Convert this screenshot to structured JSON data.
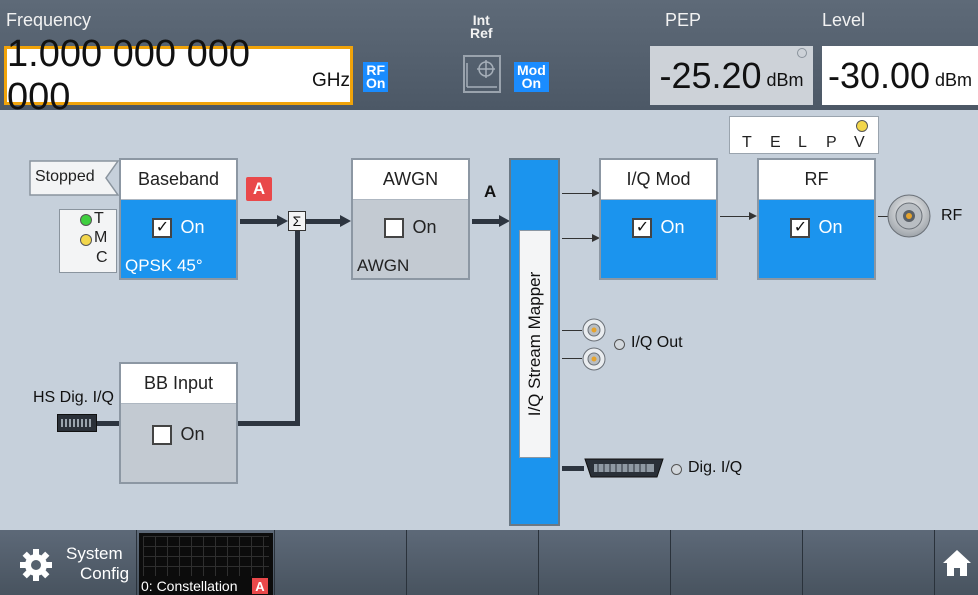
{
  "header": {
    "frequency_label": "Frequency",
    "frequency_value": "1.000 000 000 000",
    "frequency_unit": "GHz",
    "rf_status": [
      "RF",
      "On"
    ],
    "ref_label": [
      "Int",
      "Ref"
    ],
    "mod_status": [
      "Mod",
      "On"
    ],
    "pep_label": "PEP",
    "pep_value": "-25.20",
    "pep_unit": "dBm",
    "level_label": "Level",
    "level_value": "-30.00",
    "level_unit": "dBm"
  },
  "status_indicators": [
    "T",
    "E",
    "L",
    "P",
    "V"
  ],
  "diagram": {
    "stopped_label": "Stopped",
    "trigger_leds": [
      "T",
      "M",
      "C"
    ],
    "baseband": {
      "title": "Baseband",
      "state": "On",
      "sub": "QPSK 45°",
      "checked": true
    },
    "path_badge": "A",
    "sum_symbol": "Σ",
    "awgn": {
      "title": "AWGN",
      "state": "On",
      "sub": "AWGN",
      "checked": false
    },
    "awgn_out_label": "A",
    "mapper_label": "I/Q Stream Mapper",
    "iq_mod": {
      "title": "I/Q Mod",
      "state": "On",
      "checked": true
    },
    "rf": {
      "title": "RF",
      "state": "On",
      "checked": true
    },
    "rf_out_label": "RF",
    "bb_input": {
      "title": "BB Input",
      "state": "On",
      "checked": false
    },
    "hs_dig_label": "HS Dig. I/Q",
    "iq_out_label": "I/Q Out",
    "dig_iq_label": "Dig. I/Q"
  },
  "bottombar": {
    "system_config_label": [
      "System",
      "Config"
    ],
    "constellation_label": "0: Constellation",
    "constellation_badge": "A"
  },
  "colors": {
    "accent_blue": "#1b94ee",
    "focus_orange": "#f0a30a",
    "badge_red": "#e9484a",
    "led_green": "#3fcf3f",
    "led_yellow": "#f2d64b"
  }
}
